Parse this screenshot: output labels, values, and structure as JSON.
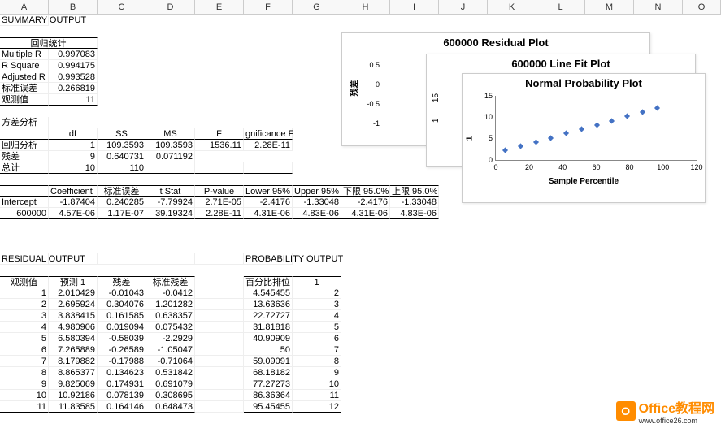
{
  "columns": [
    "A",
    "B",
    "C",
    "D",
    "E",
    "F",
    "G",
    "H",
    "I",
    "J",
    "K",
    "L",
    "M",
    "N",
    "O"
  ],
  "summary_title": "SUMMARY OUTPUT",
  "reg_stats_header": "回归统计",
  "reg_stats": {
    "multiple": {
      "label": "Multiple R",
      "val": "0.997083"
    },
    "rsquare": {
      "label": "R Square",
      "val": "0.994175"
    },
    "adjusted": {
      "label": "Adjusted R",
      "val": "0.993528"
    },
    "stderr": {
      "label": "标准误差",
      "val": "0.266819"
    },
    "obs": {
      "label": "观测值",
      "val": "11"
    }
  },
  "anova_title": "方差分析",
  "anova_headers": {
    "df": "df",
    "ss": "SS",
    "ms": "MS",
    "f": "F",
    "sig": "gnificance F"
  },
  "anova_rows": {
    "regression": {
      "label": "回归分析",
      "df": "1",
      "ss": "109.3593",
      "ms": "109.3593",
      "f": "1536.11",
      "sig": "2.28E-11"
    },
    "residual": {
      "label": "残差",
      "df": "9",
      "ss": "0.640731",
      "ms": "0.071192",
      "f": "",
      "sig": ""
    },
    "total": {
      "label": "总计",
      "df": "10",
      "ss": "110",
      "ms": "",
      "f": "",
      "sig": ""
    }
  },
  "coef_headers": {
    "coef": "Coefficient",
    "se": "标准误差",
    "t": "t Stat",
    "p": "P-value",
    "lo95": "Lower 95%",
    "up95": "Upper 95%",
    "lo95b": "下限 95.0%",
    "up95b": "上限 95.0%"
  },
  "coef_rows": {
    "intercept": {
      "label": "Intercept",
      "coef": "-1.87404",
      "se": "0.240285",
      "t": "-7.79924",
      "p": "2.71E-05",
      "lo": "-2.4176",
      "up": "-1.33048",
      "lob": "-2.4176",
      "upb": "-1.33048"
    },
    "x": {
      "label": "600000",
      "coef": "4.57E-06",
      "se": "1.17E-07",
      "t": "39.19324",
      "p": "2.28E-11",
      "lo": "4.31E-06",
      "up": "4.83E-06",
      "lob": "4.31E-06",
      "upb": "4.83E-06"
    }
  },
  "residual_title": "RESIDUAL OUTPUT",
  "prob_title": "PROBABILITY OUTPUT",
  "res_headers": {
    "obs": "观测值",
    "pred": "预测 1",
    "res": "残差",
    "stdres": "标准残差"
  },
  "prob_headers": {
    "pct": "百分比排位",
    "one": "1"
  },
  "res_rows": [
    {
      "obs": "1",
      "pred": "2.010429",
      "res": "-0.01043",
      "stdres": "-0.0412"
    },
    {
      "obs": "2",
      "pred": "2.695924",
      "res": "0.304076",
      "stdres": "1.201282"
    },
    {
      "obs": "3",
      "pred": "3.838415",
      "res": "0.161585",
      "stdres": "0.638357"
    },
    {
      "obs": "4",
      "pred": "4.980906",
      "res": "0.019094",
      "stdres": "0.075432"
    },
    {
      "obs": "5",
      "pred": "6.580394",
      "res": "-0.58039",
      "stdres": "-2.2929"
    },
    {
      "obs": "6",
      "pred": "7.265889",
      "res": "-0.26589",
      "stdres": "-1.05047"
    },
    {
      "obs": "7",
      "pred": "8.179882",
      "res": "-0.17988",
      "stdres": "-0.71064"
    },
    {
      "obs": "8",
      "pred": "8.865377",
      "res": "0.134623",
      "stdres": "0.531842"
    },
    {
      "obs": "9",
      "pred": "9.825069",
      "res": "0.174931",
      "stdres": "0.691079"
    },
    {
      "obs": "10",
      "pred": "10.92186",
      "res": "0.078139",
      "stdres": "0.308695"
    },
    {
      "obs": "11",
      "pred": "11.83585",
      "res": "0.164146",
      "stdres": "0.648473"
    }
  ],
  "prob_rows": [
    {
      "pct": "4.545455",
      "one": "2"
    },
    {
      "pct": "13.63636",
      "one": "3"
    },
    {
      "pct": "22.72727",
      "one": "4"
    },
    {
      "pct": "31.81818",
      "one": "5"
    },
    {
      "pct": "40.90909",
      "one": "6"
    },
    {
      "pct": "50",
      "one": "7"
    },
    {
      "pct": "59.09091",
      "one": "8"
    },
    {
      "pct": "68.18182",
      "one": "9"
    },
    {
      "pct": "77.27273",
      "one": "10"
    },
    {
      "pct": "86.36364",
      "one": "11"
    },
    {
      "pct": "95.45455",
      "one": "12"
    }
  ],
  "chart1": {
    "title": "600000 Residual Plot",
    "ylabel": "残差",
    "yticks": [
      "0.5",
      "0",
      "-0.5",
      "-1"
    ]
  },
  "chart2": {
    "title": "600000 Line Fit  Plot",
    "yticks": [
      "15",
      "1"
    ]
  },
  "chart3": {
    "title": "Normal Probability Plot",
    "xlabel": "Sample Percentile",
    "yticks": [
      "15",
      "10",
      "5",
      "0"
    ],
    "xticks": [
      "0",
      "20",
      "40",
      "60",
      "80",
      "100",
      "120"
    ]
  },
  "chart_data": {
    "type": "scatter",
    "title": "Normal Probability Plot",
    "xlabel": "Sample Percentile",
    "ylabel": "1",
    "xlim": [
      0,
      120
    ],
    "ylim": [
      0,
      15
    ],
    "x": [
      4.55,
      13.64,
      22.73,
      31.82,
      40.91,
      50,
      59.09,
      68.18,
      77.27,
      86.36,
      95.45
    ],
    "y": [
      2,
      3,
      4,
      5,
      6,
      7,
      8,
      9,
      10,
      11,
      12
    ]
  },
  "logo": {
    "brand": "Office教程网",
    "url": "www.office26.com",
    "icon": "O"
  }
}
